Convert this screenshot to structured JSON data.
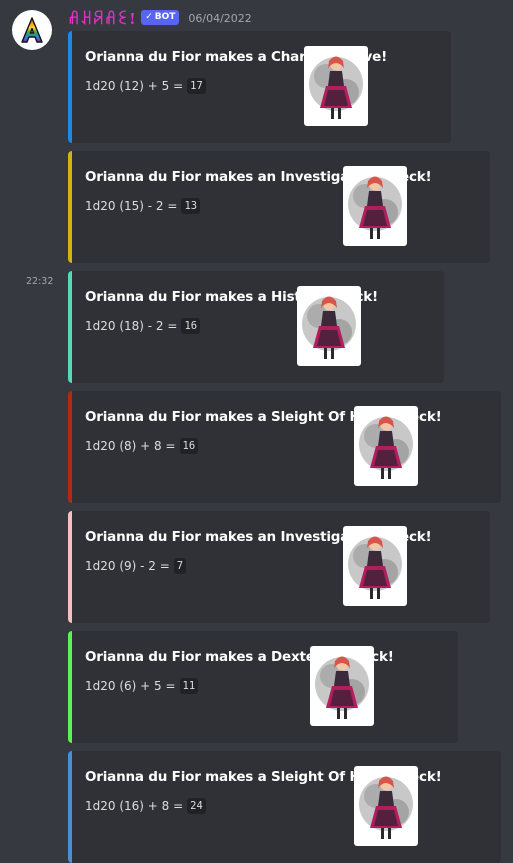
{
  "header": {
    "username": "ꋬꃅꋪꋬꏂ!",
    "bot_badge": "BOT",
    "timestamp": "06/04/2022",
    "side_time": "22:32"
  },
  "embeds": [
    {
      "title": "Orianna du Fior makes a Charisma Save!",
      "roll": "1d20 (12) + 5 =",
      "result": "17",
      "color": "#1e88e5"
    },
    {
      "title": "Orianna du Fior makes an Investigation check!",
      "roll": "1d20 (15) - 2 =",
      "result": "13",
      "color": "#d4b20f"
    },
    {
      "title": "Orianna du Fior makes a History check!",
      "roll": "1d20 (18) - 2 =",
      "result": "16",
      "color": "#57d9b7"
    },
    {
      "title": "Orianna du Fior makes a Sleight Of Hand check!",
      "roll": "1d20 (8) + 8 =",
      "result": "16",
      "color": "#b22a16"
    },
    {
      "title": "Orianna du Fior makes an Investigation check!",
      "roll": "1d20 (9) - 2 =",
      "result": "7",
      "color": "#f5c0c3"
    },
    {
      "title": "Orianna du Fior makes a Dexterity check!",
      "roll": "1d20 (6) + 5 =",
      "result": "11",
      "color": "#5ff05a"
    },
    {
      "title": "Orianna du Fior makes a Sleight Of Hand check!",
      "roll": "1d20 (16) + 8 =",
      "result": "24",
      "color": "#4a8ed6"
    }
  ]
}
